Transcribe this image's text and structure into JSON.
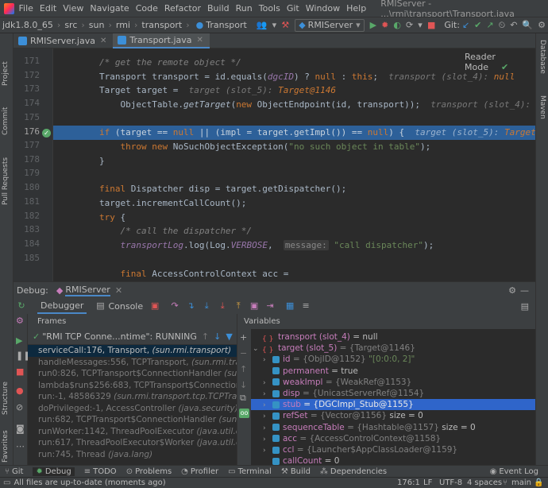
{
  "menubar": {
    "items": [
      "File",
      "Edit",
      "View",
      "Navigate",
      "Code",
      "Refactor",
      "Build",
      "Run",
      "Tools",
      "Git",
      "Window",
      "Help"
    ],
    "window_title": "RMIServer - ...\\rmi\\transport\\Transport.java"
  },
  "navbar": {
    "crumbs": [
      "jdk1.8.0_65",
      "src",
      "sun",
      "rmi",
      "transport",
      "Transport"
    ],
    "run_config": "RMIServer",
    "git_label": "Git:"
  },
  "tabs": [
    {
      "label": "RMIServer.java",
      "active": false
    },
    {
      "label": "Transport.java",
      "active": true
    }
  ],
  "editor": {
    "reader_mode": "Reader Mode",
    "line_numbers": [
      "171",
      "172",
      "173",
      "174",
      "175",
      "176",
      "177",
      "178",
      "179",
      "180",
      "181",
      "182",
      "183",
      "184",
      "185"
    ],
    "current_line": "176"
  },
  "left_strip": [
    "Project",
    "Commit",
    "Pull Requests"
  ],
  "left_strip_bottom": [
    "Structure",
    "Favorites"
  ],
  "right_strip": [
    "Database",
    "Maven"
  ],
  "debug": {
    "title": "Debug:",
    "config": "RMIServer",
    "tab_debugger": "Debugger",
    "tab_console": "Console",
    "frames_header": "Frames",
    "variables_header": "Variables",
    "thread": "\"RMI TCP Conne...ntime\": RUNNING",
    "frames": [
      {
        "method": "serviceCall:176, Transport",
        "pkg": "(sun.rmi.transport)",
        "selected": true
      },
      {
        "method": "handleMessages:556, TCPTransport",
        "pkg": "(sun.rmi.transport.tcp)",
        "selected": false
      },
      {
        "method": "run0:826, TCPTransport$ConnectionHandler",
        "pkg": "(sun.rmi.tran",
        "selected": false
      },
      {
        "method": "lambda$run$256:683, TCPTransport$ConnectionHandler",
        "pkg": "",
        "selected": false
      },
      {
        "method": "run:-1, 48586329",
        "pkg": "(sun.rmi.transport.tcp.TCPTransport$Co",
        "selected": false
      },
      {
        "method": "doPrivileged:-1, AccessController",
        "pkg": "(java.security)",
        "selected": false
      },
      {
        "method": "run:682, TCPTransport$ConnectionHandler",
        "pkg": "(sun.rmi.trans",
        "selected": false
      },
      {
        "method": "runWorker:1142, ThreadPoolExecutor",
        "pkg": "(java.util.concurrent",
        "selected": false
      },
      {
        "method": "run:617, ThreadPoolExecutor$Worker",
        "pkg": "(java.util.concurre",
        "selected": false
      },
      {
        "method": "run:745, Thread",
        "pkg": "(java.lang)",
        "selected": false
      }
    ],
    "variables": [
      {
        "name": "transport (slot_4)",
        "value": "= null",
        "type": "",
        "indent": 0,
        "expand": "",
        "icon": "local"
      },
      {
        "name": "target (slot_5)",
        "value": "",
        "type": "= {Target@1146}",
        "indent": 0,
        "expand": "v",
        "icon": "local"
      },
      {
        "name": "id",
        "value": "\"[0:0:0, 2]\"",
        "type": "= {ObjID@1152}",
        "indent": 1,
        "expand": ">",
        "icon": "field"
      },
      {
        "name": "permanent",
        "value": "= true",
        "type": "",
        "indent": 1,
        "expand": "",
        "icon": "field"
      },
      {
        "name": "weakImpl",
        "value": "",
        "type": "= {WeakRef@1153}",
        "indent": 1,
        "expand": ">",
        "icon": "field"
      },
      {
        "name": "disp",
        "value": "",
        "type": "= {UnicastServerRef@1154}",
        "indent": 1,
        "expand": ">",
        "icon": "field"
      },
      {
        "name": "stub",
        "value": "",
        "type": "= {DGCImpl_Stub@1155}",
        "indent": 1,
        "expand": ">",
        "icon": "field",
        "selected": true
      },
      {
        "name": "refSet",
        "value": "size = 0",
        "type": "= {Vector@1156}",
        "indent": 1,
        "expand": ">",
        "icon": "field"
      },
      {
        "name": "sequenceTable",
        "value": "size = 0",
        "type": "= {Hashtable@1157}",
        "indent": 1,
        "expand": ">",
        "icon": "field"
      },
      {
        "name": "acc",
        "value": "",
        "type": "= {AccessControlContext@1158}",
        "indent": 1,
        "expand": ">",
        "icon": "field"
      },
      {
        "name": "ccl",
        "value": "",
        "type": "= {Launcher$AppClassLoader@1159}",
        "indent": 1,
        "expand": ">",
        "icon": "field"
      },
      {
        "name": "callCount",
        "value": "= 0",
        "type": "",
        "indent": 1,
        "expand": "",
        "icon": "field"
      }
    ]
  },
  "bottom_tools": [
    "Git",
    "Debug",
    "TODO",
    "Problems",
    "Profiler",
    "Terminal",
    "Build",
    "Dependencies"
  ],
  "event_log": "Event Log",
  "status": {
    "message": "All files are up-to-date (moments ago)",
    "position": "176:1",
    "line_sep": "LF",
    "encoding": "UTF-8",
    "indent": "4 spaces",
    "branch": "main"
  },
  "colors": {
    "background": "#2b2b2b",
    "panel": "#3c3f41",
    "highlight_line": "#2d6099",
    "keyword": "#cc7832",
    "string": "#6a8759",
    "field": "#9876aa",
    "selected_var": "#2f65ca"
  }
}
